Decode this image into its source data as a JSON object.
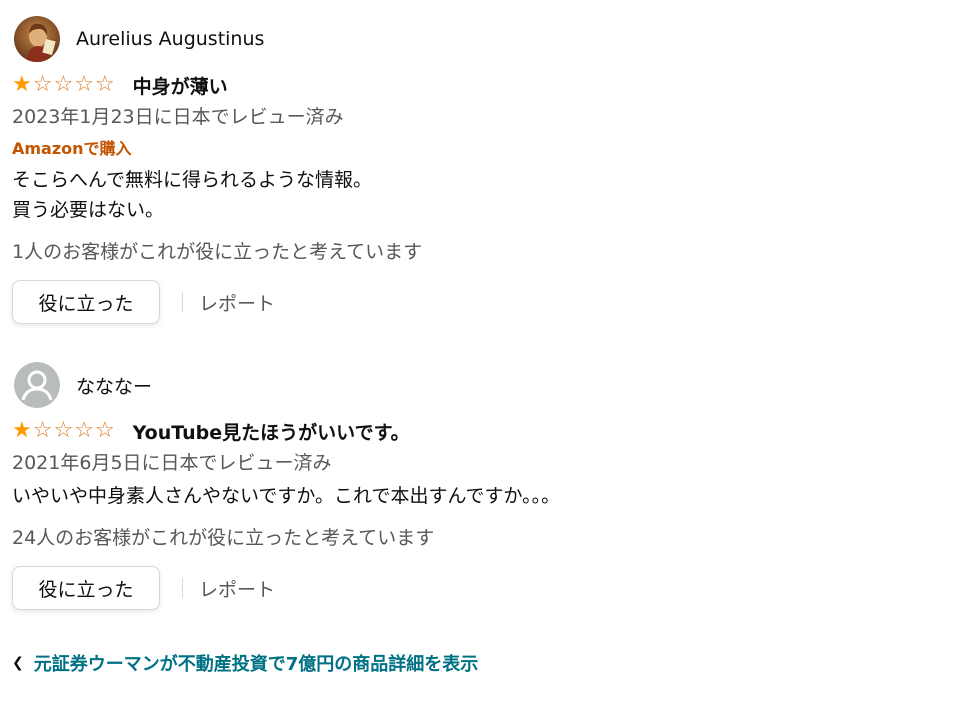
{
  "reviews": [
    {
      "reviewer": "Aurelius Augustinus",
      "avatar_icon": "painted-portrait-avatar",
      "rating": 1,
      "rating_max": 5,
      "title": "中身が薄い",
      "date": "2023年1月23日に日本でレビュー済み",
      "verified": "Amazonで購入",
      "body": [
        "そこらへんで無料に得られるような情報。",
        "買う必要はない。"
      ],
      "helpful_count": "1人のお客様がこれが役に立ったと考えています",
      "helpful_button": "役に立った",
      "report": "レポート"
    },
    {
      "reviewer": "なななー",
      "avatar_icon": "default-user-avatar",
      "rating": 1,
      "rating_max": 5,
      "title": "YouTube見たほうがいいです。",
      "date": "2021年6月5日に日本でレビュー済み",
      "body": [
        "いやいや中身素人さんやないですか。これで本出すんですか。。。"
      ],
      "helpful_count": "24人のお客様がこれが役に立ったと考えています",
      "helpful_button": "役に立った",
      "report": "レポート"
    }
  ],
  "footer_link": {
    "icon": "chevron-left-icon",
    "text": "元証券ウーマンが不動産投資で7億円の商品詳細を表示"
  },
  "colors": {
    "star": "#de7921",
    "verified": "#c45500",
    "link": "#007185",
    "secondary_text": "#565959"
  }
}
